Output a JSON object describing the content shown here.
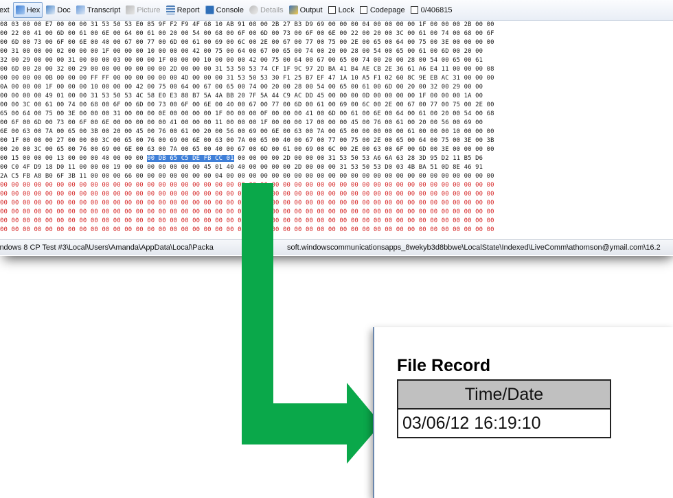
{
  "toolbar": {
    "text": "ext",
    "hex": "Hex",
    "doc": "Doc",
    "transcript": "Transcript",
    "picture": "Picture",
    "report": "Report",
    "console": "Console",
    "details": "Details",
    "output": "Output",
    "lock": "Lock",
    "codepage": "Codepage",
    "offset": "0/406815"
  },
  "hex": {
    "rows": [
      "08 03 00 00 E7 00 00 00 31 53 50 53 E0 85 9F F2 F9 4F 68 10 AB 91 08 00 2B 27 B3 D9 69 00 00 00 04 00 00 00 00 1F 00 00 00 2B 00 00",
      "00 22 00 41 00 6D 00 61 00 6E 00 64 00 61 00 20 00 54 00 68 00 6F 00 6D 00 73 00 6F 00 6E 00 22 00 20 00 3C 00 61 00 74 00 68 00 6F",
      "00 6D 00 73 00 6F 00 6E 00 40 00 67 00 77 00 6D 00 61 00 69 00 6C 00 2E 00 67 00 77 00 75 00 2E 00 65 00 64 00 75 00 3E 00 00 00 00",
      "00 31 00 00 00 02 00 00 00 1F 00 00 00 10 00 00 00 42 00 75 00 64 00 67 00 65 00 74 00 20 00 28 00 54 00 65 00 61 00 6D 00 20 00",
      "32 00 29 00 00 00 31 00 00 00 03 00 00 00 1F 00 00 00 10 00 00 00 42 00 75 00 64 00 67 00 65 00 74 00 20 00 28 00 54 00 65 00 61",
      "00 6D 00 20 00 32 00 29 00 00 00 00 00 00 00 2D 00 00 00 31 53 50 53 74 CF 1F 9C 97 2D BA 41 B4 AE CB 2E 36 61 A6 E4 11 00 00 00 08",
      "00 00 00 00 0B 00 00 00 FF FF 00 00 00 00 00 00 4D 00 00 00 31 53 50 53 30 F1 25 B7 EF 47 1A 10 A5 F1 02 60 8C 9E EB AC 31 00 00 00",
      "0A 00 00 00 1F 00 00 00 10 00 00 00 42 00 75 00 64 00 67 00 65 00 74 00 20 00 28 00 54 00 65 00 61 00 6D 00 20 00 32 00 29 00 00",
      "00 00 00 00 49 01 00 00 31 53 50 53 4C 58 E0 E3 88 B7 5A 4A BB 20 7F 5A 44 C9 AC DD 45 00 00 00 0D 00 00 00 00 1F 00 00 00 1A 00",
      "00 00 3C 00 61 00 74 00 68 00 6F 00 6D 00 73 00 6F 00 6E 00 40 00 67 00 77 00 6D 00 61 00 69 00 6C 00 2E 00 67 00 77 00 75 00 2E 00",
      "65 00 64 00 75 00 3E 00 00 00 31 00 00 00 0E 00 00 00 00 1F 00 00 00 0F 00 00 00 41 00 6D 00 61 00 6E 00 64 00 61 00 20 00 54 00 68",
      "00 6F 00 6D 00 73 00 6F 00 6E 00 00 00 00 00 41 00 00 00 11 00 00 00 1F 00 00 00 17 00 00 00 45 00 76 00 61 00 20 00 56 00 69 00",
      "6E 00 63 00 7A 00 65 00 3B 00 20 00 45 00 76 00 61 00 20 00 56 00 69 00 6E 00 63 00 7A 00 65 00 00 00 00 00 61 00 00 00 10 00 00 00",
      "00 1F 00 00 00 27 00 00 00 3C 00 65 00 76 00 69 00 6E 00 63 00 7A 00 65 00 40 00 67 00 77 00 75 00 2E 00 65 00 64 00 75 00 3E 00 3B",
      "00 20 00 3C 00 65 00 76 00 69 00 6E 00 63 00 7A 00 65 00 40 00 67 00 6D 00 61 00 69 00 6C 00 2E 00 63 00 6F 00 6D 00 3E 00 00 00 00",
      "00 15 00 00 00 13 00 00 00 40 00 00 00 00 DB 65 C5 DE FB CC 01 00 00 00 00 2D 00 00 00 31 53 50 53 A6 6A 63 28 3D 95 D2 11 B5 D6",
      "00 C0 4F D9 18 D0 11 00 00 00 19 00 00 00 00 00 00 00 45 01 40 40 00 00 00 00 2D 00 00 00 31 53 50 53 D0 03 4B BA 51 0D 8E 46 91",
      "2A C5 FB A8 B0 6F 3B 11 00 00 00 66 00 00 00 00 00 00 00 04 00 00 00 00 00 00 00 00 00 00 00 00 00 00 00 00 00 00 00 00 00 00 00 00",
      "00 00 00 00 00 00 00 00 00 00 00 00 00 00 00 00 00 00 00 00 00 00 00 00 00 00 00 00 00 00 00 00 00 00 00 00 00 00 00 00 00 00 00 00",
      "00 00 00 00 00 00 00 00 00 00 00 00 00 00 00 00 00 00 00 00 00 00 00 00 00 00 00 00 00 00 00 00 00 00 00 00 00 00 00 00 00 00 00 00",
      "00 00 00 00 00 00 00 00 00 00 00 00 00 00 00 00 00 00 00 00 00 00 00 00 00 00 00 00 00 00 00 00 00 00 00 00 00 00 00 00 00 00 00 00",
      "00 00 00 00 00 00 00 00 00 00 00 00 00 00 00 00 00 00 00 00 00 00 00 00 00 00 00 00 00 00 00 00 00 00 00 00 00 00 00 00 00 00 00 00",
      "00 00 00 00 00 00 00 00 00 00 00 00 00 00 00 00 00 00 00 00 00 00 00 00 00 00 00 00 00 00 00 00 00 00 00 00 00 00 00 00 00 00 00 00",
      "00 00 00 00 00 00 00 00 00 00 00 00 00 00 00 00 00 00 00 00 00 00 00 00 00 00 00 00 00 00 00 00 00 00 00 00 00 00 00 00 00 00 00 00"
    ],
    "selected": "00 DB 65 C5 DE FB CC 01",
    "zero_fill_color": "#d42020",
    "selection_color": "#3f7fd8"
  },
  "status": {
    "left": "indows 8 CP Test #3\\Local\\Users\\Amanda\\AppData\\Local\\Packa",
    "right": "soft.windowscommunicationsapps_8wekyb3d8bbwe\\LocalState\\Indexed\\LiveComm\\athomson@ymail.com\\16.2"
  },
  "arrow_color": "#0aa84a",
  "record": {
    "title": "File Record",
    "column": "Time/Date",
    "value": "03/06/12 16:19:10"
  }
}
